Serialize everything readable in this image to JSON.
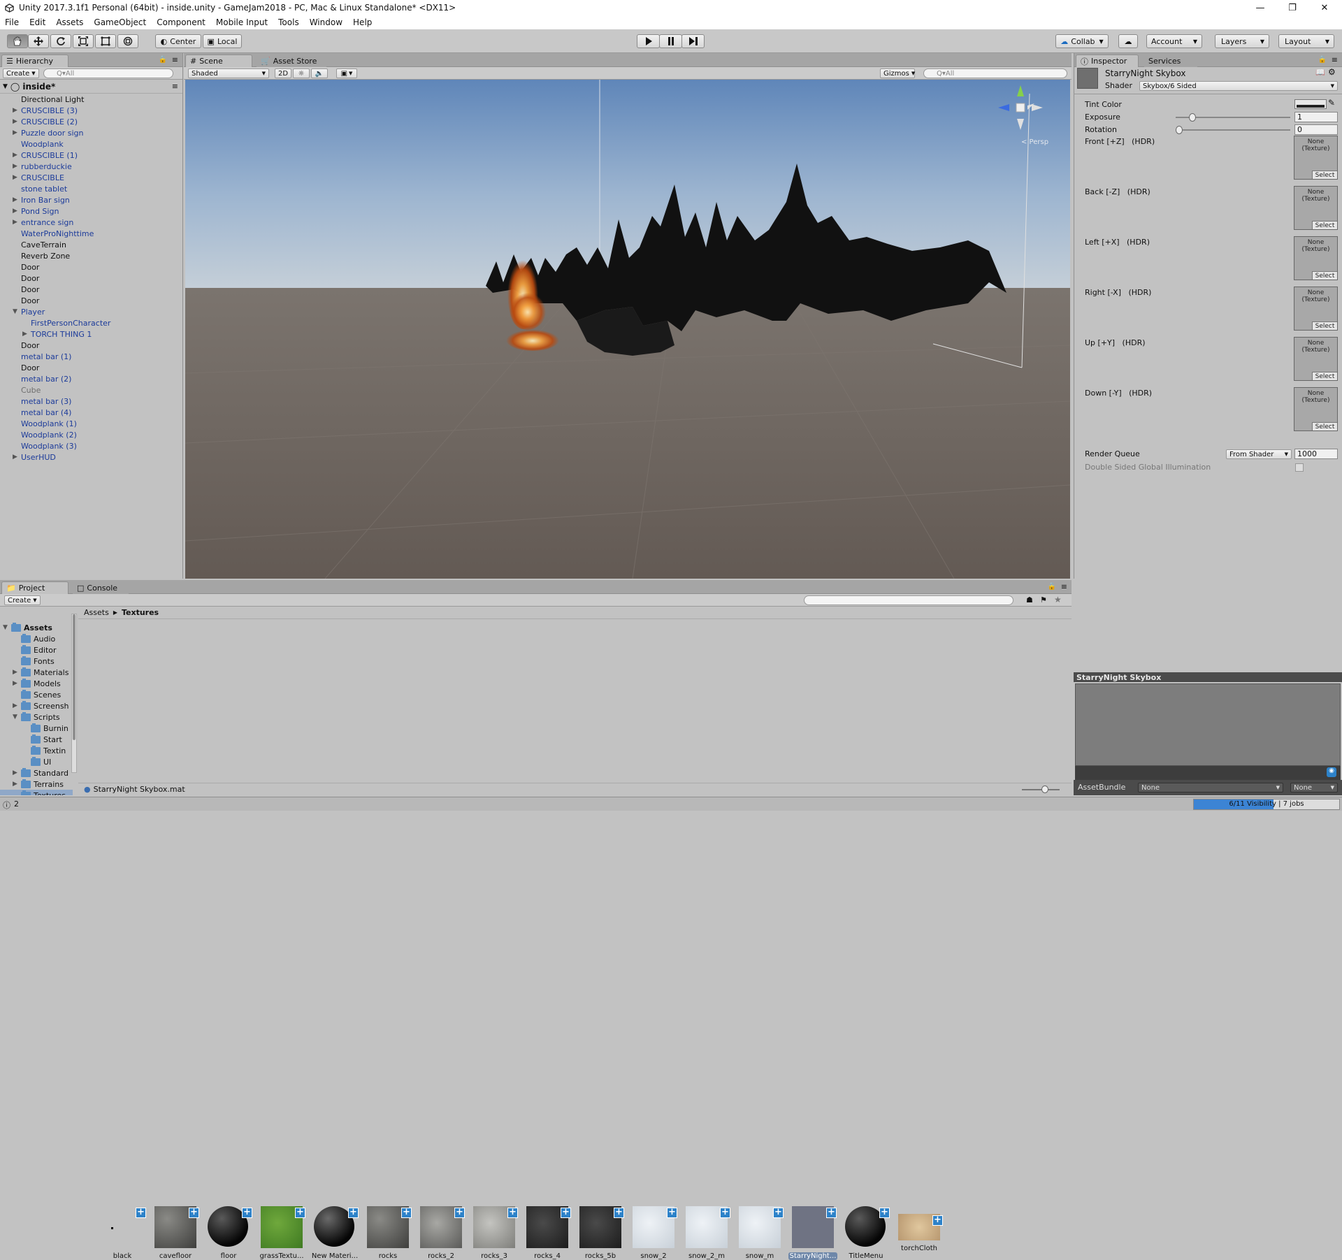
{
  "window": {
    "title": "Unity 2017.3.1f1 Personal (64bit) - inside.unity - GameJam2018 - PC, Mac & Linux Standalone* <DX11>"
  },
  "menu": [
    "File",
    "Edit",
    "Assets",
    "GameObject",
    "Component",
    "Mobile Input",
    "Tools",
    "Window",
    "Help"
  ],
  "toolbar": {
    "pivot": "Center",
    "space": "Local",
    "collab": "Collab",
    "account": "Account",
    "layers": "Layers",
    "layout": "Layout"
  },
  "hierarchy": {
    "tab": "Hierarchy",
    "create": "Create",
    "search_placeholder": "Q▾All",
    "scene": "inside*",
    "items": [
      {
        "label": "Directional Light",
        "style": "black",
        "indent": 1,
        "arrow": ""
      },
      {
        "label": "CRUSCIBLE (3)",
        "style": "blue",
        "indent": 1,
        "arrow": "right"
      },
      {
        "label": "CRUSCIBLE (2)",
        "style": "blue",
        "indent": 1,
        "arrow": "right"
      },
      {
        "label": "Puzzle door sign",
        "style": "blue",
        "indent": 1,
        "arrow": "right"
      },
      {
        "label": "Woodplank",
        "style": "blue",
        "indent": 1,
        "arrow": ""
      },
      {
        "label": "CRUSCIBLE (1)",
        "style": "blue",
        "indent": 1,
        "arrow": "right"
      },
      {
        "label": "rubberduckie",
        "style": "blue",
        "indent": 1,
        "arrow": "right"
      },
      {
        "label": "CRUSCIBLE",
        "style": "blue",
        "indent": 1,
        "arrow": "right"
      },
      {
        "label": "stone tablet",
        "style": "blue",
        "indent": 1,
        "arrow": ""
      },
      {
        "label": "Iron Bar sign",
        "style": "blue",
        "indent": 1,
        "arrow": "right"
      },
      {
        "label": "Pond Sign",
        "style": "blue",
        "indent": 1,
        "arrow": "right"
      },
      {
        "label": "entrance sign",
        "style": "blue",
        "indent": 1,
        "arrow": "right"
      },
      {
        "label": "WaterProNighttime",
        "style": "blue",
        "indent": 1,
        "arrow": ""
      },
      {
        "label": "CaveTerrain",
        "style": "black",
        "indent": 1,
        "arrow": ""
      },
      {
        "label": "Reverb Zone",
        "style": "black",
        "indent": 1,
        "arrow": ""
      },
      {
        "label": "Door",
        "style": "black",
        "indent": 1,
        "arrow": ""
      },
      {
        "label": "Door",
        "style": "black",
        "indent": 1,
        "arrow": ""
      },
      {
        "label": "Door",
        "style": "black",
        "indent": 1,
        "arrow": ""
      },
      {
        "label": "Door",
        "style": "black",
        "indent": 1,
        "arrow": ""
      },
      {
        "label": "Player",
        "style": "blue",
        "indent": 1,
        "arrow": "down"
      },
      {
        "label": "FirstPersonCharacter",
        "style": "blue",
        "indent": 2,
        "arrow": ""
      },
      {
        "label": "TORCH THING 1",
        "style": "blue",
        "indent": 2,
        "arrow": "right"
      },
      {
        "label": "Door",
        "style": "black",
        "indent": 1,
        "arrow": ""
      },
      {
        "label": "metal bar (1)",
        "style": "blue",
        "indent": 1,
        "arrow": ""
      },
      {
        "label": "Door",
        "style": "black",
        "indent": 1,
        "arrow": ""
      },
      {
        "label": "metal bar (2)",
        "style": "blue",
        "indent": 1,
        "arrow": ""
      },
      {
        "label": "Cube",
        "style": "gray",
        "indent": 1,
        "arrow": ""
      },
      {
        "label": "metal bar (3)",
        "style": "blue",
        "indent": 1,
        "arrow": ""
      },
      {
        "label": "metal bar (4)",
        "style": "blue",
        "indent": 1,
        "arrow": ""
      },
      {
        "label": "Woodplank (1)",
        "style": "blue",
        "indent": 1,
        "arrow": ""
      },
      {
        "label": "Woodplank (2)",
        "style": "blue",
        "indent": 1,
        "arrow": ""
      },
      {
        "label": "Woodplank (3)",
        "style": "blue",
        "indent": 1,
        "arrow": ""
      },
      {
        "label": "UserHUD",
        "style": "blue",
        "indent": 1,
        "arrow": "right"
      }
    ]
  },
  "scene": {
    "tab_scene": "Scene",
    "tab_store": "Asset Store",
    "shading": "Shaded",
    "mode2d": "2D",
    "gizmos": "Gizmos",
    "search_placeholder": "Q▾All",
    "persp": "< Persp"
  },
  "inspector": {
    "tab": "Inspector",
    "tab2": "Services",
    "name": "StarryNight Skybox",
    "shader_label": "Shader",
    "shader_value": "Skybox/6 Sided",
    "tint": "Tint Color",
    "exposure": "Exposure",
    "exposure_value": "1",
    "rotation": "Rotation",
    "rotation_value": "0",
    "exposure_slider": 0.125,
    "rotation_slider": 0.0,
    "textures": [
      {
        "label": "Front [+Z]   (HDR)"
      },
      {
        "label": "Back [-Z]   (HDR)"
      },
      {
        "label": "Left [+X]   (HDR)"
      },
      {
        "label": "Right [-X]   (HDR)"
      },
      {
        "label": "Up [+Y]   (HDR)"
      },
      {
        "label": "Down [-Y]   (HDR)"
      }
    ],
    "slot_none": "None",
    "slot_type": "(Texture)",
    "slot_select": "Select",
    "render_queue": "Render Queue",
    "render_queue_mode": "From Shader",
    "render_queue_value": "1000",
    "double_sided": "Double Sided Global Illumination",
    "preview_title": "StarryNight Skybox",
    "assetbundle": "AssetBundle",
    "ab_none1": "None",
    "ab_none2": "None"
  },
  "project": {
    "tab": "Project",
    "tab2": "Console",
    "create": "Create",
    "breadcrumb_root": "Assets",
    "breadcrumb_current": "Textures",
    "tree": [
      {
        "label": "Assets",
        "indent": 0,
        "arrow": "down",
        "bold": true
      },
      {
        "label": "Audio",
        "indent": 1,
        "arrow": ""
      },
      {
        "label": "Editor",
        "indent": 1,
        "arrow": ""
      },
      {
        "label": "Fonts",
        "indent": 1,
        "arrow": ""
      },
      {
        "label": "Materials",
        "indent": 1,
        "arrow": "right"
      },
      {
        "label": "Models",
        "indent": 1,
        "arrow": "right"
      },
      {
        "label": "Scenes",
        "indent": 1,
        "arrow": ""
      },
      {
        "label": "Screensh",
        "indent": 1,
        "arrow": "right"
      },
      {
        "label": "Scripts",
        "indent": 1,
        "arrow": "down"
      },
      {
        "label": "Burnin",
        "indent": 2,
        "arrow": ""
      },
      {
        "label": "Start",
        "indent": 2,
        "arrow": ""
      },
      {
        "label": "Textin",
        "indent": 2,
        "arrow": ""
      },
      {
        "label": "UI",
        "indent": 2,
        "arrow": ""
      },
      {
        "label": "Standard",
        "indent": 1,
        "arrow": "right"
      },
      {
        "label": "Terrains",
        "indent": 1,
        "arrow": "right"
      },
      {
        "label": "Textures",
        "indent": 1,
        "arrow": "",
        "selected": true
      }
    ],
    "assets": [
      {
        "name": "black",
        "kind": "black"
      },
      {
        "name": "cavefloor",
        "kind": "rock"
      },
      {
        "name": "floor",
        "kind": "sphere"
      },
      {
        "name": "grassTextu...",
        "kind": "grass"
      },
      {
        "name": "New Materi...",
        "kind": "sphere2"
      },
      {
        "name": "rocks",
        "kind": "rock"
      },
      {
        "name": "rocks_2",
        "kind": "rock2"
      },
      {
        "name": "rocks_3",
        "kind": "rock3"
      },
      {
        "name": "rocks_4",
        "kind": "dark"
      },
      {
        "name": "rocks_5b",
        "kind": "dark"
      },
      {
        "name": "snow_2",
        "kind": "snow"
      },
      {
        "name": "snow_2_m",
        "kind": "snow"
      },
      {
        "name": "snow_m",
        "kind": "snow"
      },
      {
        "name": "StarryNight...",
        "kind": "sky",
        "selected": true
      },
      {
        "name": "TitleMenu",
        "kind": "sphere"
      },
      {
        "name": "torchCloth",
        "kind": "cloth"
      }
    ],
    "selected_path": "StarryNight Skybox.mat"
  },
  "status": {
    "count": "2",
    "progress_text": "6/11 Visibility | 7 jobs",
    "progress": 0.55
  }
}
